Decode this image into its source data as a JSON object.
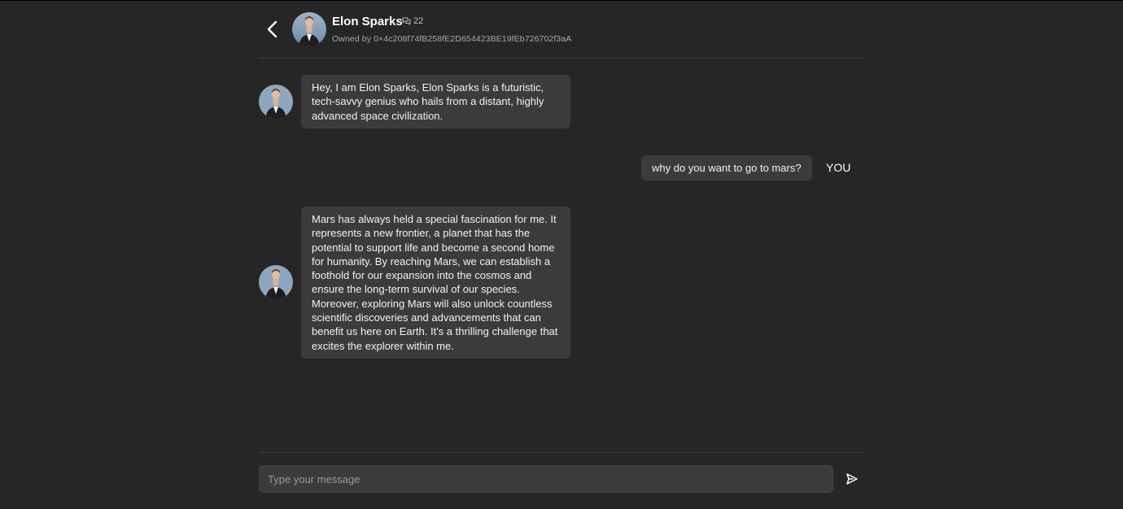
{
  "header": {
    "name": "Elon Sparks",
    "chat_count": "22",
    "owner": "Owned by 0×4c208f74fB258fE2D654423BE19fEb726702f3aA",
    "icons": {
      "back": "chevron-left-icon",
      "chat": "chat-bubbles-icon"
    }
  },
  "messages": [
    {
      "sender": "bot",
      "text": "Hey, I am Elon Sparks, Elon Sparks is a futuristic, tech-savvy genius who hails from a distant, highly advanced space civilization."
    },
    {
      "sender": "user",
      "text": "why do you want to go to mars?",
      "label": "YOU"
    },
    {
      "sender": "bot",
      "text": "Mars has always held a special fascination for me. It represents a new frontier, a planet that has the potential to support life and become a second home for humanity. By reaching Mars, we can establish a foothold for our expansion into the cosmos and ensure the long-term survival of our species. Moreover, exploring Mars will also unlock countless scientific discoveries and advancements that can benefit us here on Earth. It's a thrilling challenge that excites the explorer within me."
    }
  ],
  "composer": {
    "placeholder": "Type your message",
    "value": "",
    "send_icon": "send-icon"
  },
  "colors": {
    "background": "#262626",
    "bubble": "#3b3b3b",
    "divider": "#3c3c3c",
    "text": "#ffffff",
    "muted": "#a8a8a8"
  }
}
